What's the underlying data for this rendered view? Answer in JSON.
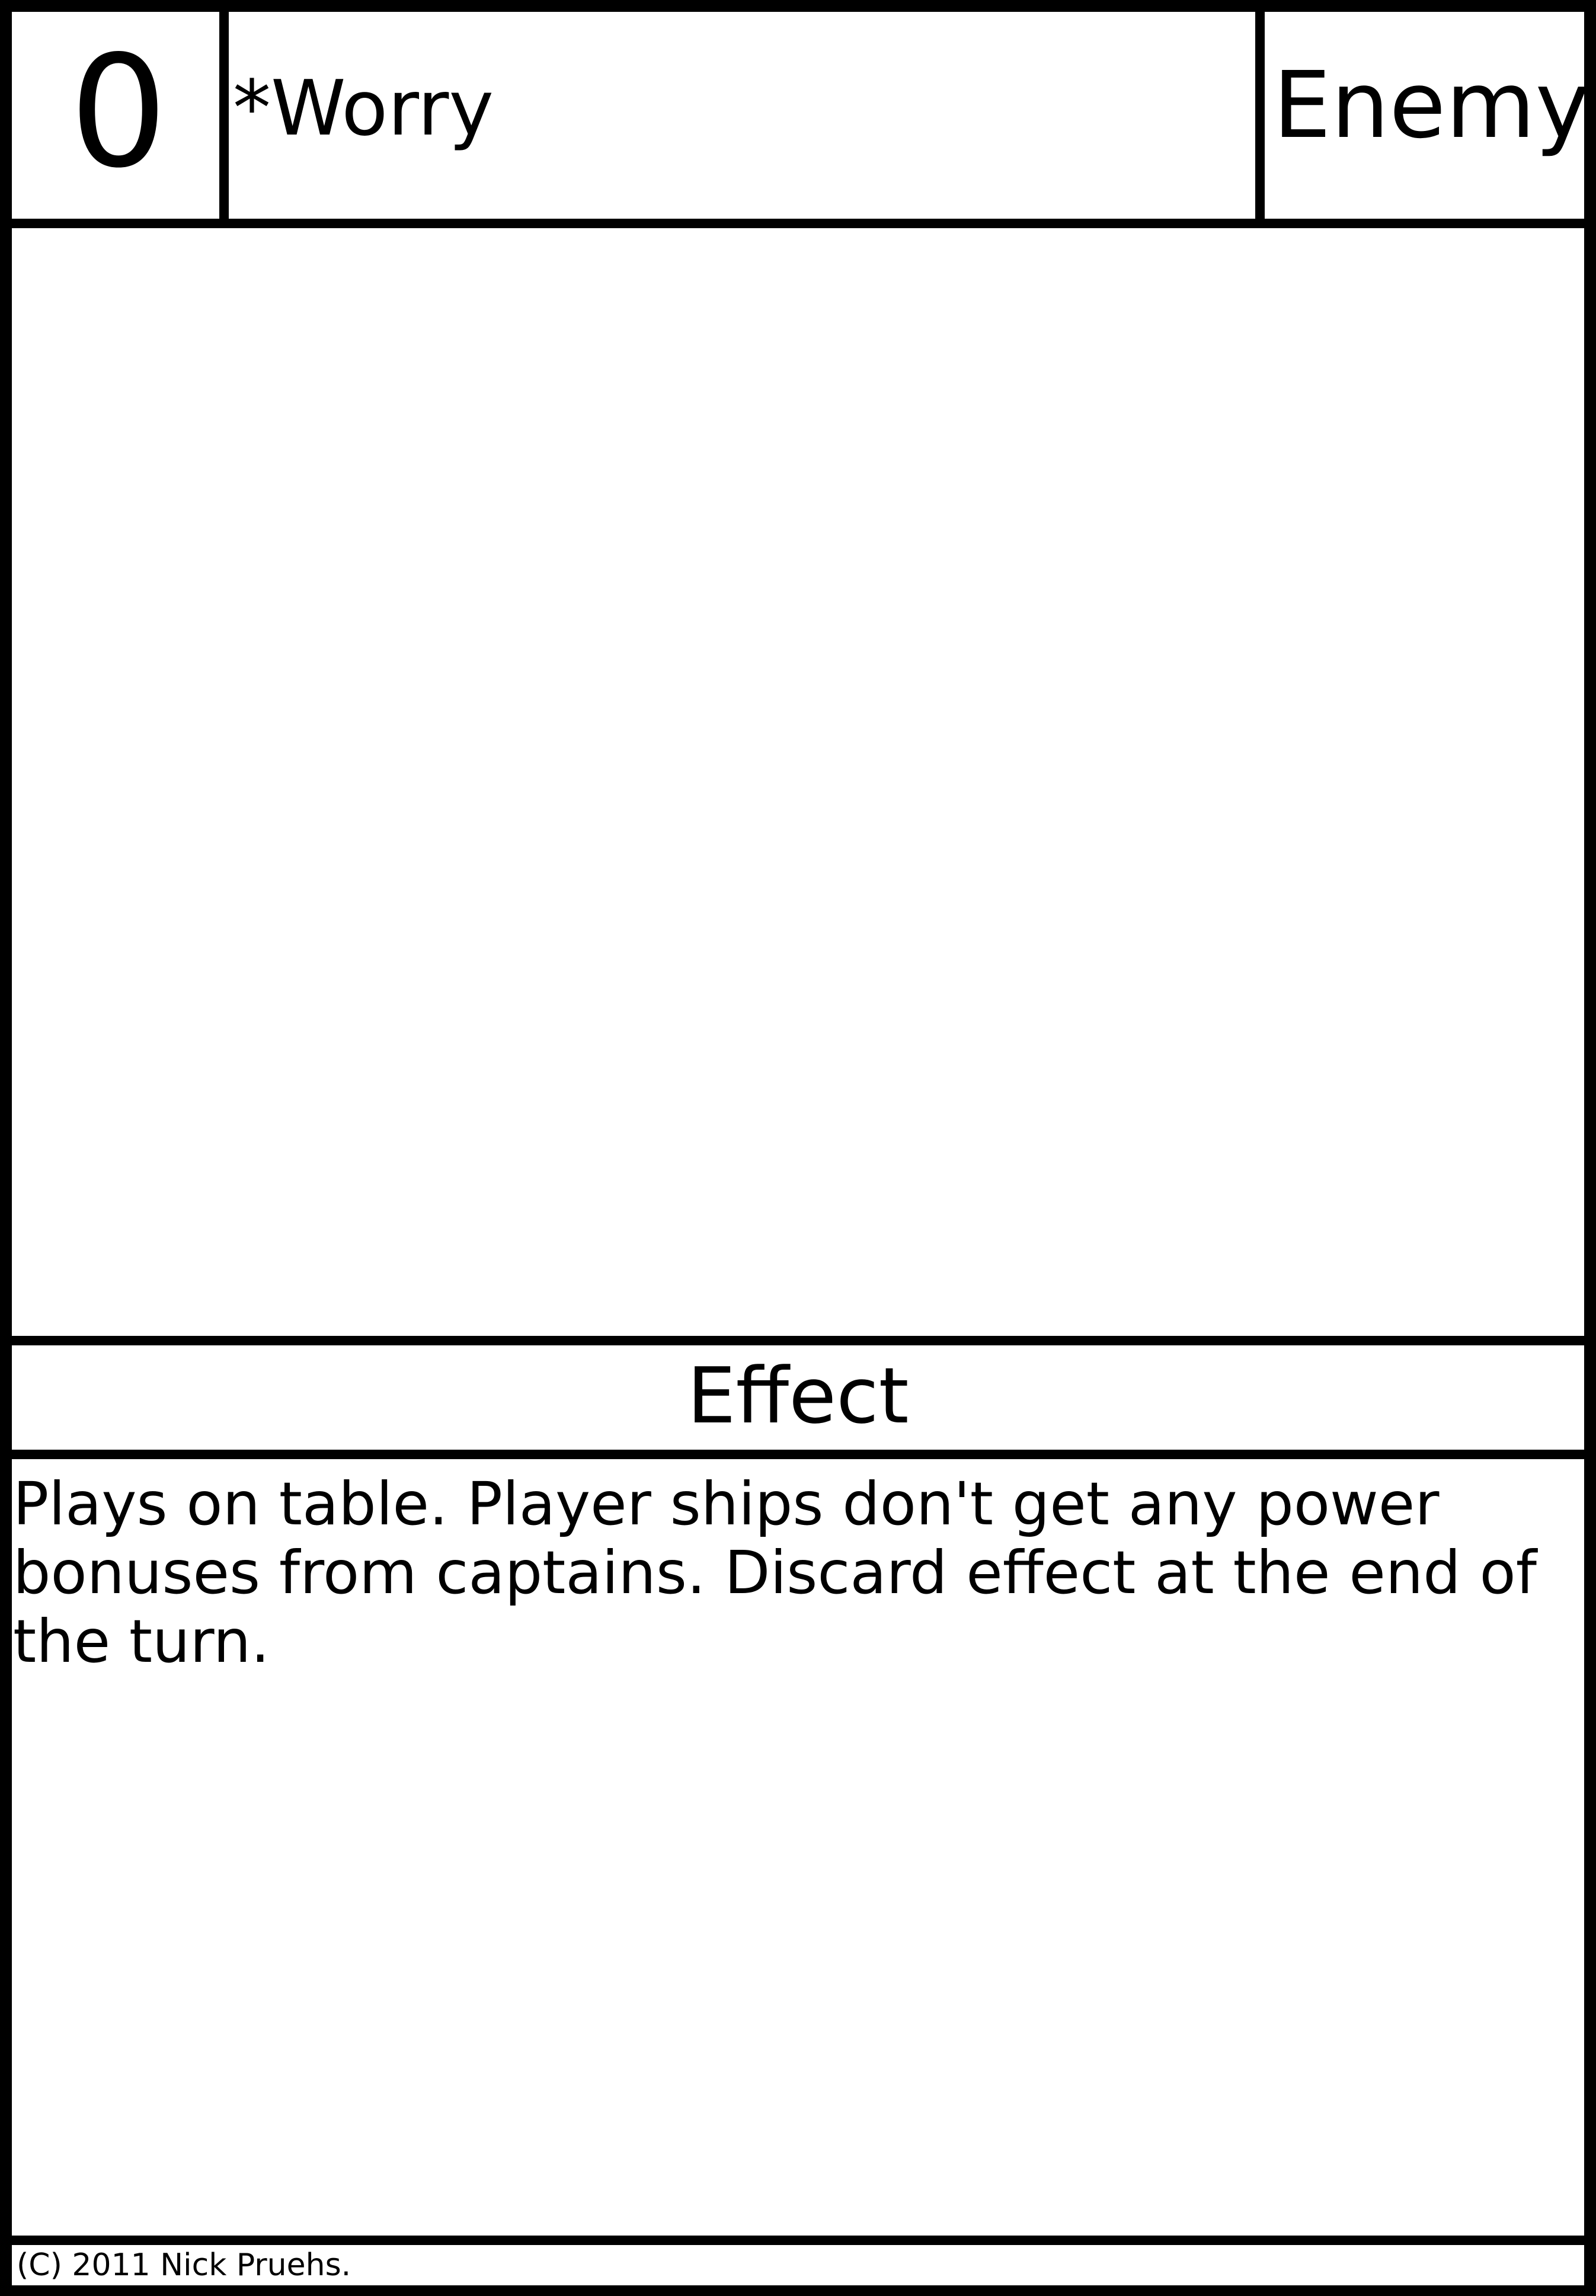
{
  "card": {
    "cost": "0",
    "name": "*Worry",
    "type": "Enemy",
    "effect_heading": "Effect",
    "effect_text": "Plays on table. Player ships don't get any power bonuses from captains. Discard effect at the end of the turn.",
    "copyright": "(C) 2011 Nick Pruehs."
  },
  "colors": {
    "border": "#000000",
    "background": "#ffffff"
  }
}
